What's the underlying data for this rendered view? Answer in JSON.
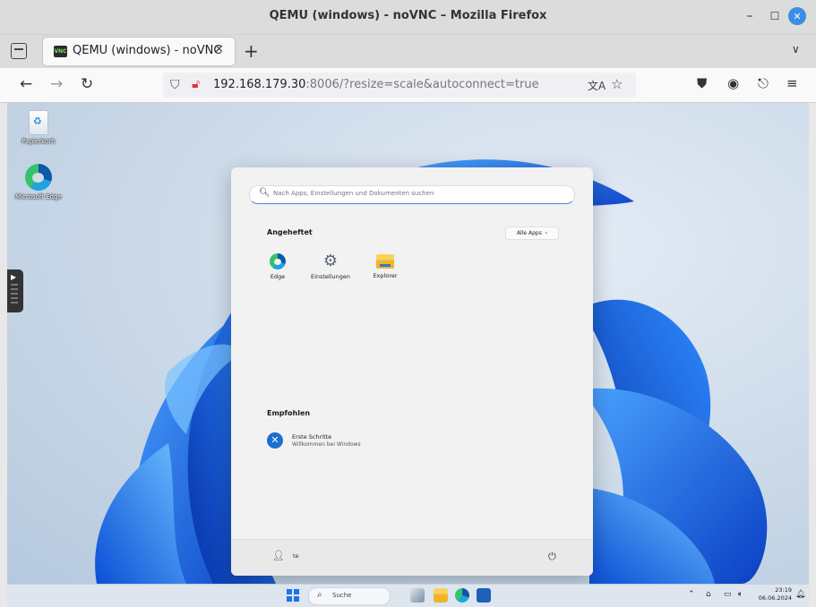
{
  "window": {
    "title": "QEMU (windows) - noVNC – Mozilla Firefox"
  },
  "tab": {
    "favicon_text": "VNC",
    "label": "QEMU (windows) - noVNC"
  },
  "address": {
    "host": "192.168.179.30",
    "rest": ":8006/?resize=scale&autoconnect=true"
  },
  "desktop": {
    "icons": [
      {
        "label": "Papierkorb"
      },
      {
        "label": "Microsoft Edge"
      }
    ]
  },
  "start_menu": {
    "search_placeholder": "Nach Apps, Einstellungen und Dokumenten suchen",
    "pinned_title": "Angeheftet",
    "all_apps_label": "Alle Apps",
    "pinned": [
      {
        "label": "Edge"
      },
      {
        "label": "Einstellungen"
      },
      {
        "label": "Explorer"
      }
    ],
    "recommended_title": "Empfohlen",
    "recommended": [
      {
        "title": "Erste Schritte",
        "subtitle": "Willkommen bei Windows"
      }
    ],
    "user_name": "te"
  },
  "taskbar": {
    "search_label": "Suche",
    "time": "23:19",
    "date": "06.06.2024"
  },
  "colors": {
    "accent": "#1a73e8",
    "tab_close_button": "#3a8ee6"
  }
}
